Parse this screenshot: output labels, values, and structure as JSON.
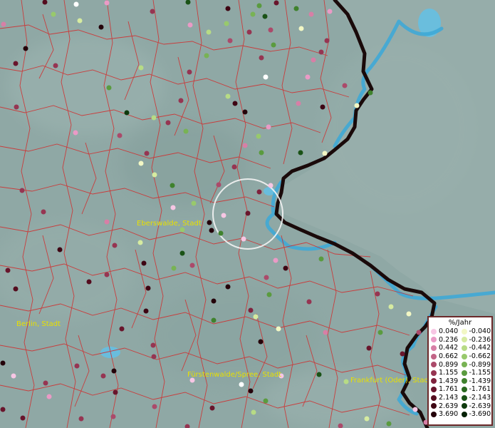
{
  "map": {
    "place_labels": [
      {
        "id": "eberswalde",
        "text": "Eberswalde, Stadt"
      },
      {
        "id": "berlin",
        "text": "Berlin, Stadt"
      },
      {
        "id": "fuerstenwalde",
        "text": "Fürstenwalde/Spree, Stadt"
      },
      {
        "id": "frankfurt",
        "text": "Frankfurt (Oder), Stadt"
      }
    ],
    "colors": {
      "background": "#8fa8a5",
      "boundary": "#d22b2b",
      "river": "#3fa9d6",
      "border": "#1a0a0a",
      "label": "#e8e000"
    }
  },
  "legend": {
    "title": "%/Jahr",
    "positive": [
      {
        "value": "0.040",
        "color": "#f7c6e4"
      },
      {
        "value": "0.236",
        "color": "#ea9ac6"
      },
      {
        "value": "0.442",
        "color": "#d77fa6"
      },
      {
        "value": "0.662",
        "color": "#c26487"
      },
      {
        "value": "0.899",
        "color": "#ab4a6a"
      },
      {
        "value": "1.155",
        "color": "#963552"
      },
      {
        "value": "1.439",
        "color": "#7f223d"
      },
      {
        "value": "1.761",
        "color": "#69152c"
      },
      {
        "value": "2.143",
        "color": "#540c1e"
      },
      {
        "value": "2.639",
        "color": "#3e0513"
      },
      {
        "value": "3.690",
        "color": "#24020a"
      }
    ],
    "negative": [
      {
        "value": "-0.040",
        "color": "#f2f7c4"
      },
      {
        "value": "-0.236",
        "color": "#d6eba0"
      },
      {
        "value": "-0.442",
        "color": "#b7db85"
      },
      {
        "value": "-0.662",
        "color": "#98c96c"
      },
      {
        "value": "-0.899",
        "color": "#78b354"
      },
      {
        "value": "-1.155",
        "color": "#5a9b3f"
      },
      {
        "value": "-1.439",
        "color": "#3f822d"
      },
      {
        "value": "-1.761",
        "color": "#2a6a20"
      },
      {
        "value": "-2.143",
        "color": "#1a5216"
      },
      {
        "value": "-2.639",
        "color": "#0e3a0d"
      },
      {
        "value": "-3.690",
        "color": "#062206"
      }
    ]
  }
}
